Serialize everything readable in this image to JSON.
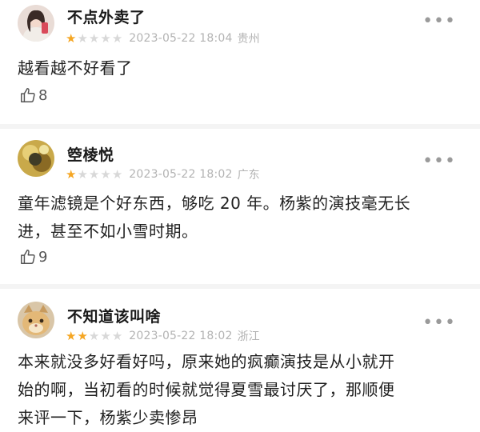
{
  "reviews": [
    {
      "username": "不点外卖了",
      "rating": 1,
      "max_rating": 5,
      "date": "2023-05-22 18:04",
      "region": "贵州",
      "content": "越看越不好看了",
      "likes": "8",
      "more_icon": "more-horizontal-icon"
    },
    {
      "username": "箜棱悦",
      "rating": 1,
      "max_rating": 5,
      "date": "2023-05-22 18:02",
      "region": "广东",
      "content_line1": "童年滤镜是个好东西，够吃 20 年。杨紫的演技毫无长",
      "content_line2": "进，甚至不如小雪时期。",
      "likes": "9",
      "more_icon": "more-horizontal-icon"
    },
    {
      "username": "不知道该叫啥",
      "rating": 2,
      "max_rating": 5,
      "date": "2023-05-22 18:02",
      "region": "浙江",
      "content_line1": "本来就没多好看好吗，原来她的疯癫演技是从小就开",
      "content_line2": "始的啊，当初看的时候就觉得夏雪最讨厌了，那顺便",
      "content_line3": "来评一下，杨紫少卖惨昂",
      "more_icon": "more-horizontal-icon"
    }
  ],
  "colors": {
    "star_on": "#f5a623",
    "star_off": "#d8d8d8",
    "meta_text": "#b3b3b3",
    "divider": "#f4f4f4"
  },
  "icons": {
    "like": "thumbs-up-icon",
    "star": "star-icon",
    "avatar": "avatar-image"
  }
}
